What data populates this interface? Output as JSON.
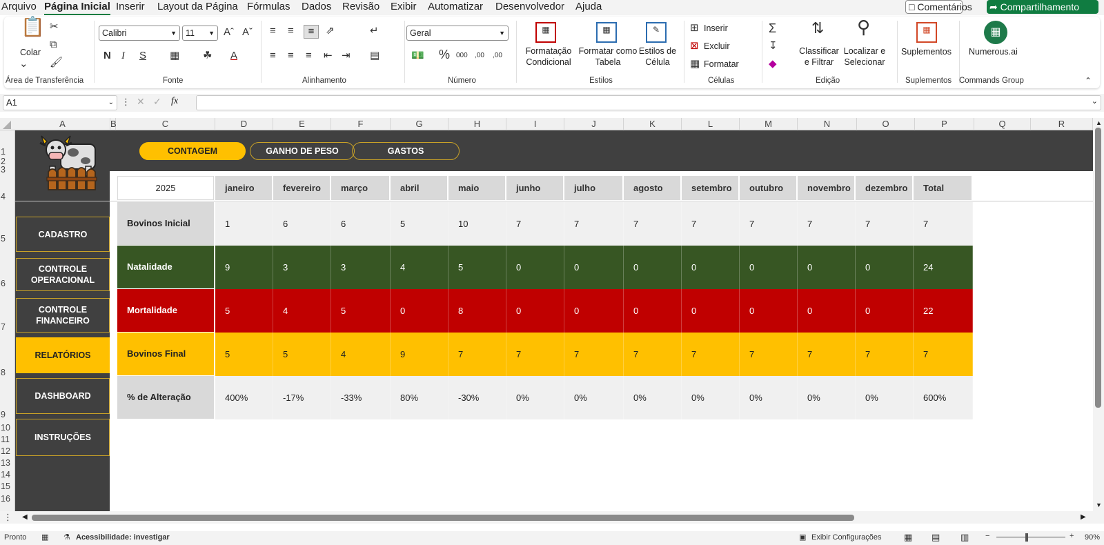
{
  "menu": {
    "items": [
      "Arquivo",
      "Página Inicial",
      "Inserir",
      "Layout da Página",
      "Fórmulas",
      "Dados",
      "Revisão",
      "Exibir",
      "Automatizar",
      "Desenvolvedor",
      "Ajuda"
    ],
    "comments": "Comentários",
    "share": "Compartilhamento"
  },
  "ribbon": {
    "paste": "Colar",
    "font_name": "Calibri",
    "font_size": "11",
    "number_format": "Geral",
    "cond_format": [
      "Formatação",
      "Condicional"
    ],
    "format_table": [
      "Formatar como",
      "Tabela"
    ],
    "cell_styles": [
      "Estilos de",
      "Célula"
    ],
    "insert": "Inserir",
    "delete": "Excluir",
    "format": "Formatar",
    "sort_filter": [
      "Classificar",
      "e Filtrar"
    ],
    "find_select": [
      "Localizar e",
      "Selecionar"
    ],
    "addins": "Suplementos",
    "numerous": "Numerous.ai",
    "groups": [
      "Área de Transferência",
      "Fonte",
      "Alinhamento",
      "Número",
      "Estilos",
      "Células",
      "Edição",
      "Suplementos",
      "Commands Group"
    ]
  },
  "formula_bar": {
    "name_box": "A1",
    "fx": "fx",
    "content": ""
  },
  "columns": [
    "A",
    "B",
    "C",
    "D",
    "E",
    "F",
    "G",
    "H",
    "I",
    "J",
    "K",
    "L",
    "M",
    "N",
    "O",
    "P",
    "Q",
    "R"
  ],
  "rows": [
    "1",
    "2",
    "3",
    "4",
    "5",
    "6",
    "7",
    "8",
    "9",
    "10",
    "11",
    "12",
    "13",
    "14",
    "15",
    "16"
  ],
  "tabs": [
    "CONTAGEM",
    "GANHO DE PESO",
    "GASTOS"
  ],
  "nav": [
    "CADASTRO",
    "CONTROLE OPERACIONAL",
    "CONTROLE FINANCEIRO",
    "RELATÓRIOS",
    "DASHBOARD",
    "INSTRUÇÕES"
  ],
  "report": {
    "year": "2025",
    "months": [
      "janeiro",
      "fevereiro",
      "março",
      "abril",
      "maio",
      "junho",
      "julho",
      "agosto",
      "setembro",
      "outubro",
      "novembro",
      "dezembro",
      "Total"
    ],
    "rows": [
      {
        "label": "Bovinos Inicial",
        "values": [
          "1",
          "6",
          "6",
          "5",
          "10",
          "7",
          "7",
          "7",
          "7",
          "7",
          "7",
          "7",
          "7"
        ],
        "bg": "#f0f0f0",
        "label_bg": "#d9d9d9",
        "color": "#222"
      },
      {
        "label": "Natalidade",
        "values": [
          "9",
          "3",
          "3",
          "4",
          "5",
          "0",
          "0",
          "0",
          "0",
          "0",
          "0",
          "0",
          "24"
        ],
        "bg": "#375623",
        "label_bg": "#375623",
        "color": "#ffffff"
      },
      {
        "label": "Mortalidade",
        "values": [
          "5",
          "4",
          "5",
          "0",
          "8",
          "0",
          "0",
          "0",
          "0",
          "0",
          "0",
          "0",
          "22"
        ],
        "bg": "#c00000",
        "label_bg": "#c00000",
        "color": "#ffffff"
      },
      {
        "label": "Bovinos Final",
        "values": [
          "5",
          "5",
          "4",
          "9",
          "7",
          "7",
          "7",
          "7",
          "7",
          "7",
          "7",
          "7",
          "7"
        ],
        "bg": "#ffc000",
        "label_bg": "#ffc000",
        "color": "#222"
      },
      {
        "label": "% de Alteração",
        "values": [
          "400%",
          "-17%",
          "-33%",
          "80%",
          "-30%",
          "0%",
          "0%",
          "0%",
          "0%",
          "0%",
          "0%",
          "0%",
          "600%"
        ],
        "bg": "#f0f0f0",
        "label_bg": "#d9d9d9",
        "color": "#222"
      }
    ]
  },
  "status": {
    "ready": "Pronto",
    "accessibility": "Acessibilidade: investigar",
    "display_settings": "Exibir Configurações",
    "zoom": "90%"
  },
  "colors": {
    "accent": "#107c41",
    "dark": "#404040",
    "gold": "#ffc000"
  }
}
